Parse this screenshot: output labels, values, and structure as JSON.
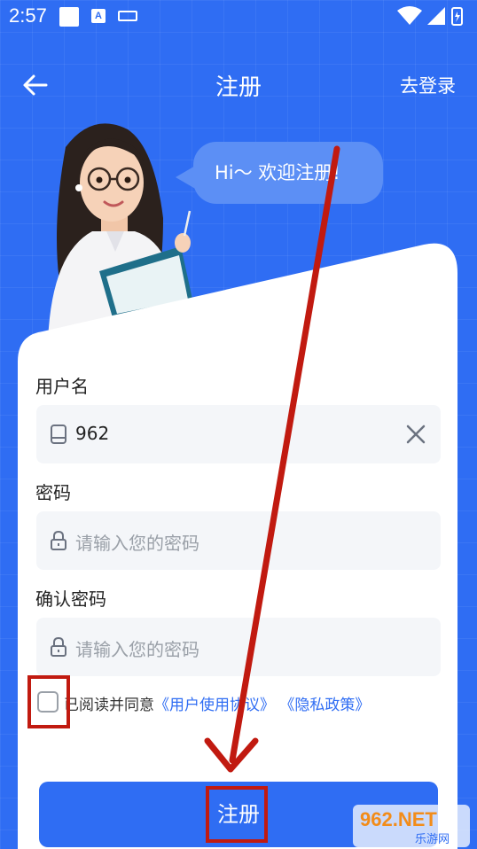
{
  "status_bar": {
    "time": "2:57",
    "a_icon": "A"
  },
  "header": {
    "title": "注册",
    "go_login": "去登录"
  },
  "bubble": {
    "text": "Hi～ 欢迎注册!"
  },
  "form": {
    "username": {
      "label": "用户名",
      "value": "962",
      "icon": "phone-icon"
    },
    "password": {
      "label": "密码",
      "placeholder": "请输入您的密码",
      "icon": "lock-icon"
    },
    "confirm": {
      "label": "确认密码",
      "placeholder": "请输入您的密码",
      "icon": "lock-icon"
    },
    "agree": {
      "prefix": "已阅读并同意",
      "user_agreement": "《用户使用协议》",
      "privacy_policy": "《隐私政策》",
      "checked": false
    },
    "submit_label": "注册"
  },
  "watermark": {
    "brand": "962.NET",
    "sub": "乐游网"
  },
  "colors": {
    "primary": "#2f6df3",
    "annotation": "#c11a10",
    "field_bg": "#f4f6f9"
  }
}
